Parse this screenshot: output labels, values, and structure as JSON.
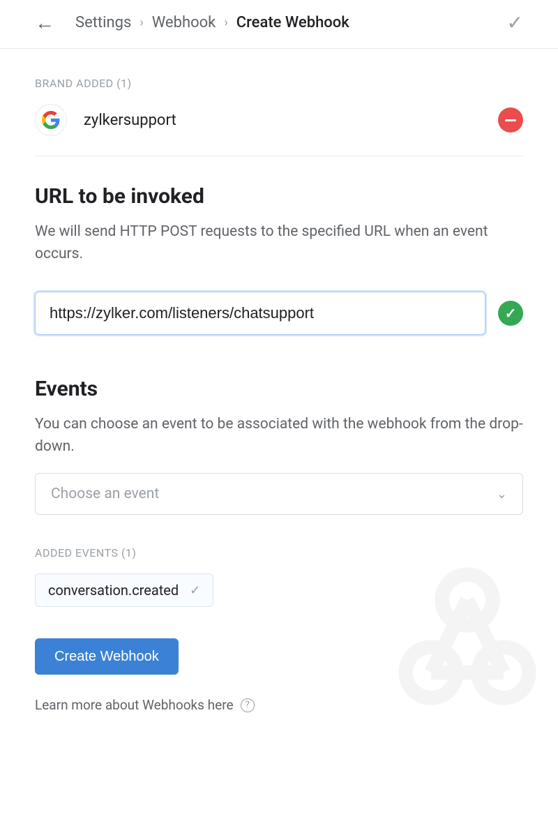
{
  "breadcrumb": {
    "items": [
      "Settings",
      "Webhook"
    ],
    "current": "Create Webhook"
  },
  "brandAdded": {
    "label": "BRAND ADDED (1)",
    "name": "zylkersupport"
  },
  "url": {
    "title": "URL to be invoked",
    "description": "We will send HTTP POST requests to the specified URL when an event occurs.",
    "value": "https://zylker.com/listeners/chatsupport"
  },
  "events": {
    "title": "Events",
    "description": "You can choose an event to be associated with the webhook from the drop-down.",
    "placeholder": "Choose an event",
    "addedLabel": "ADDED EVENTS (1)",
    "items": [
      "conversation.created"
    ]
  },
  "actions": {
    "create": "Create Webhook",
    "learnMore": "Learn more about Webhooks here"
  }
}
